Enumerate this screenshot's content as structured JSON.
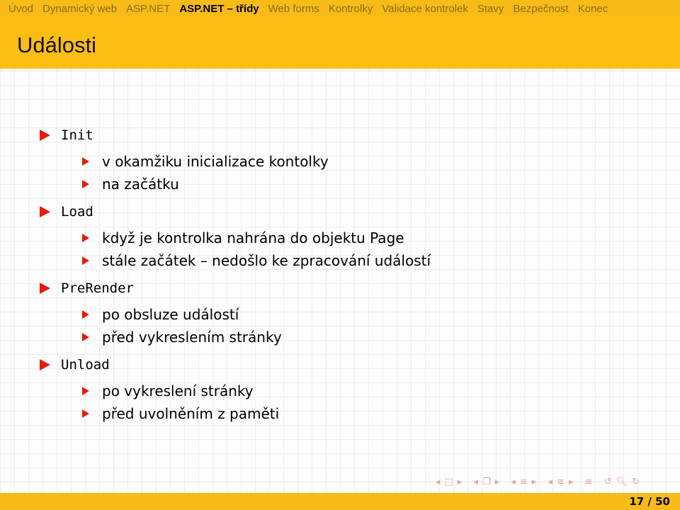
{
  "nav": {
    "items": [
      "Úvod",
      "Dynamický web",
      "ASP.NET",
      "ASP.NET – třídy",
      "Web forms",
      "Kontrolky",
      "Validace kontrolek",
      "Stavy",
      "Bezpečnost",
      "Konec"
    ],
    "active_index": 3
  },
  "title": "Události",
  "items": [
    {
      "label": "Init",
      "sub": [
        "v okamžiku inicializace kontolky",
        "na začátku"
      ]
    },
    {
      "label": "Load",
      "sub": [
        "když je kontrolka nahrána do objektu Page",
        "stále začátek – nedošlo ke zpracování událostí"
      ]
    },
    {
      "label": "PreRender",
      "sub": [
        "po obsluze událostí",
        "před vykreslením stránky"
      ]
    },
    {
      "label": "Unload",
      "sub": [
        "po vykreslení stránky",
        "před uvolněním z paměti"
      ]
    }
  ],
  "footer": {
    "page": "17 / 50"
  },
  "colors": {
    "bar": "#f8bb17",
    "bullet": "#e61b0c"
  }
}
